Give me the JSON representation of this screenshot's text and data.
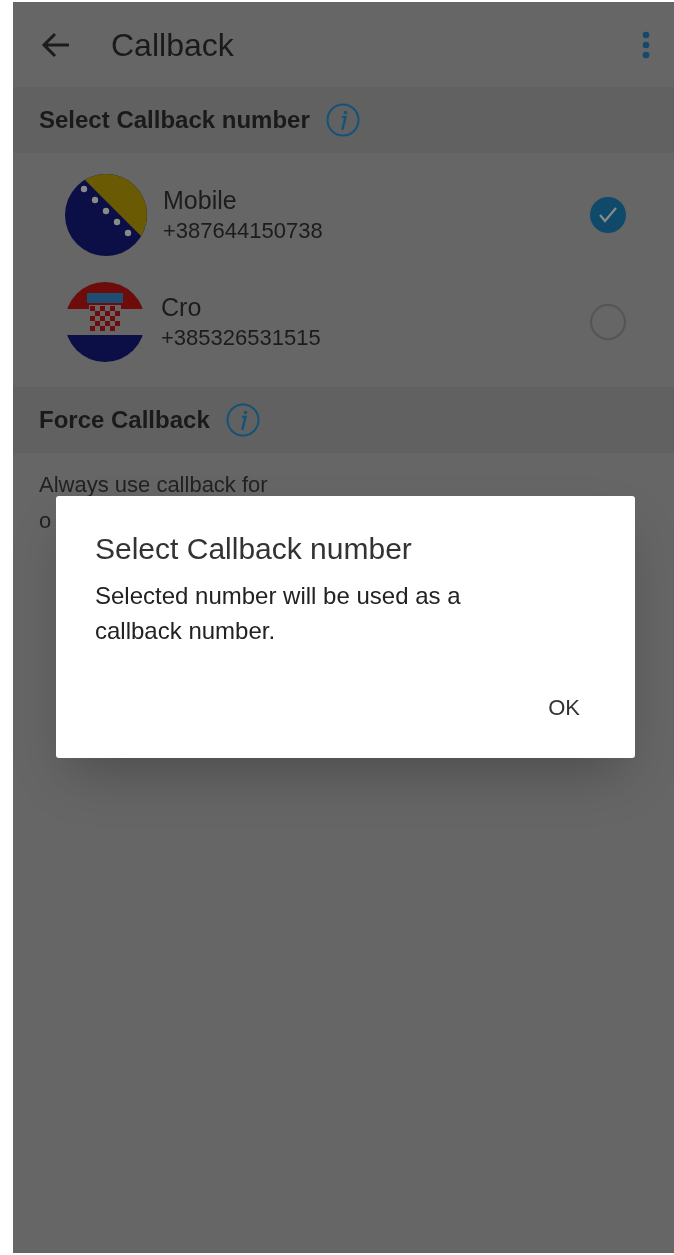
{
  "app_bar": {
    "title": "Callback"
  },
  "sections": [
    {
      "kind": "numbers",
      "title": "Select Callback number",
      "items": [
        {
          "name": "Mobile",
          "number": "+387644150738",
          "kind": "bosnia",
          "selected": true
        },
        {
          "name": "Cro",
          "number": "+385326531515",
          "kind": "croatia",
          "selected": false
        }
      ]
    },
    {
      "kind": "setting",
      "title": "Force Callback",
      "setting_lines": [
        "Always use callback for",
        "o"
      ]
    }
  ],
  "dialog": {
    "title": "Select Callback number",
    "message": "Selected number will be used as a callback number.",
    "buttons": [
      "OK"
    ]
  }
}
